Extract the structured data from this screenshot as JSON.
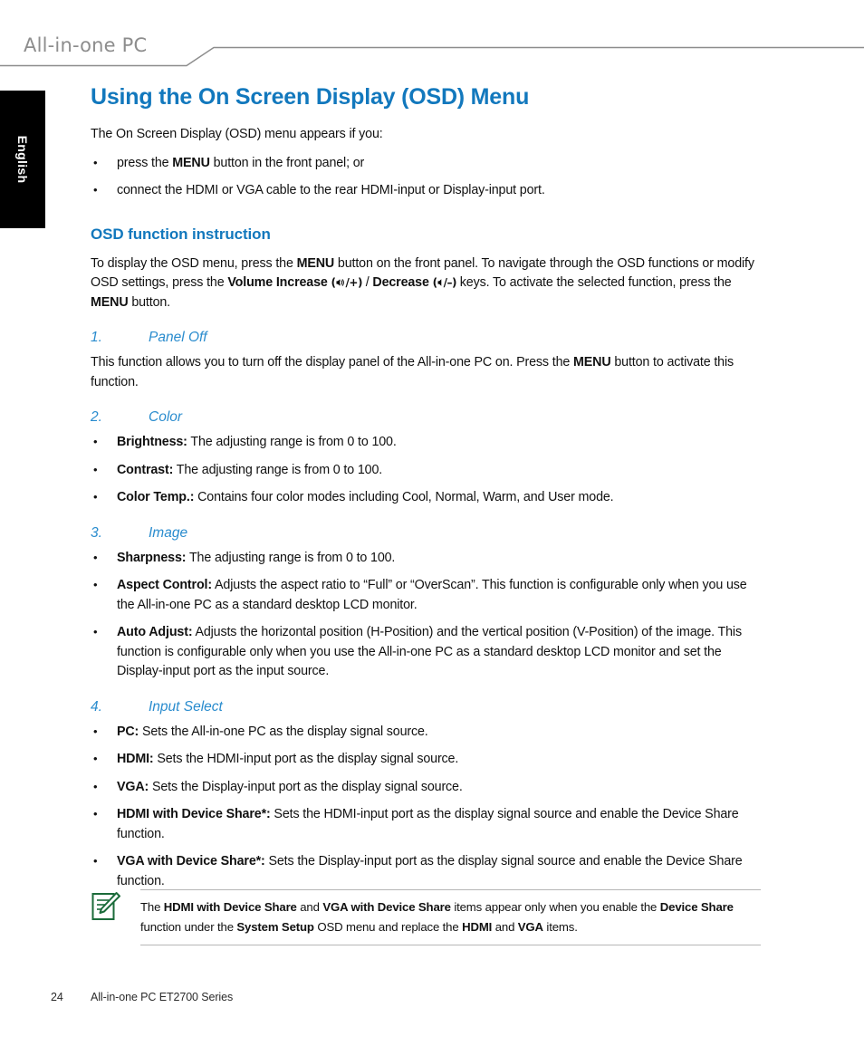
{
  "header": {
    "product_title": "All-in-one PC",
    "rule_color": "#8d8d8d"
  },
  "sidebar": {
    "language_tab": "English",
    "background": "#000000"
  },
  "colors": {
    "heading_blue": "#1278bd",
    "list_blue": "#2a8cce",
    "note_icon_green": "#1b6b3a",
    "rule_gray": "#b6b6b6"
  },
  "main": {
    "title": "Using the On Screen Display (OSD) Menu",
    "intro": "The On Screen Display (OSD) menu appears if you:",
    "intro_bullets": [
      {
        "prefix": "press the ",
        "bold": "MENU",
        "suffix": " button in the front panel; or"
      },
      {
        "prefix": "connect the HDMI or VGA cable to the rear HDMI-input or Display-input port.",
        "bold": "",
        "suffix": ""
      }
    ],
    "section_heading": "OSD function instruction",
    "instruction_paragraph": {
      "part1": "To display the OSD menu, press the ",
      "bold1": "MENU",
      "part2": " button on the front panel. To navigate through the OSD functions or modify OSD settings, press the ",
      "bold2": "Volume Increase",
      "glyph_up": "(◂б/+)",
      "part3": " / ",
      "bold3": "Decrease",
      "glyph_down": "(◂/–)",
      "part4": " keys. To activate the selected function, press the ",
      "bold4": "MENU",
      "part5": " button."
    },
    "items": [
      {
        "number": "1.",
        "label": "Panel Off",
        "paragraph": {
          "part1": "This function allows you to turn off the display panel of the All-in-one PC on. Press the ",
          "bold1": "MENU",
          "part2": " button to activate this function."
        },
        "bullets": []
      },
      {
        "number": "2.",
        "label": "Color",
        "paragraph": null,
        "bullets": [
          {
            "term": "Brightness:",
            "text": " The adjusting range is from 0 to 100."
          },
          {
            "term": "Contrast:",
            "text": " The adjusting range is from 0 to 100."
          },
          {
            "term": "Color Temp.:",
            "text": " Contains four color modes including Cool, Normal, Warm, and User mode."
          }
        ]
      },
      {
        "number": "3.",
        "label": "Image",
        "paragraph": null,
        "bullets": [
          {
            "term": "Sharpness:",
            "text": " The adjusting range is from 0 to 100."
          },
          {
            "term": "Aspect Control:",
            "text": " Adjusts the aspect ratio to “Full” or “OverScan”. This function is configurable only when you use the All-in-one PC as a standard desktop LCD monitor."
          },
          {
            "term": "Auto Adjust:",
            "text": " Adjusts the horizontal position (H-Position) and the vertical position (V-Position) of the image. This function is configurable only when you use the All-in-one PC as a standard desktop LCD monitor and set the Display-input port as the input source."
          }
        ]
      },
      {
        "number": "4.",
        "label": "Input Select",
        "paragraph": null,
        "bullets": [
          {
            "term": "PC:",
            "text": " Sets the All-in-one PC as the display signal source."
          },
          {
            "term": "HDMI:",
            "text": " Sets the HDMI-input port as the display signal source."
          },
          {
            "term": "VGA:",
            "text": " Sets the Display-input port as the display signal source."
          },
          {
            "term": "HDMI with Device Share*:",
            "text": " Sets the HDMI-input port as the display signal source and enable the Device Share function."
          },
          {
            "term": "VGA with Device Share*:",
            "text": " Sets the Display-input port as the display signal source and enable the Device Share function."
          }
        ]
      }
    ]
  },
  "note": {
    "icon_name": "note-pencil-icon",
    "text": {
      "part1": "The ",
      "bold1": "HDMI with Device Share",
      "part2": " and ",
      "bold2": "VGA with Device Share",
      "part3": " items appear only when you enable the ",
      "bold3": "Device Share",
      "part4": " function under the ",
      "bold4": "System Setup",
      "part5": " OSD menu and replace the ",
      "bold5": "HDMI",
      "part6": " and ",
      "bold6": "VGA",
      "part7": " items."
    }
  },
  "footer": {
    "page_number": "24",
    "document_name": "All-in-one PC ET2700 Series"
  }
}
